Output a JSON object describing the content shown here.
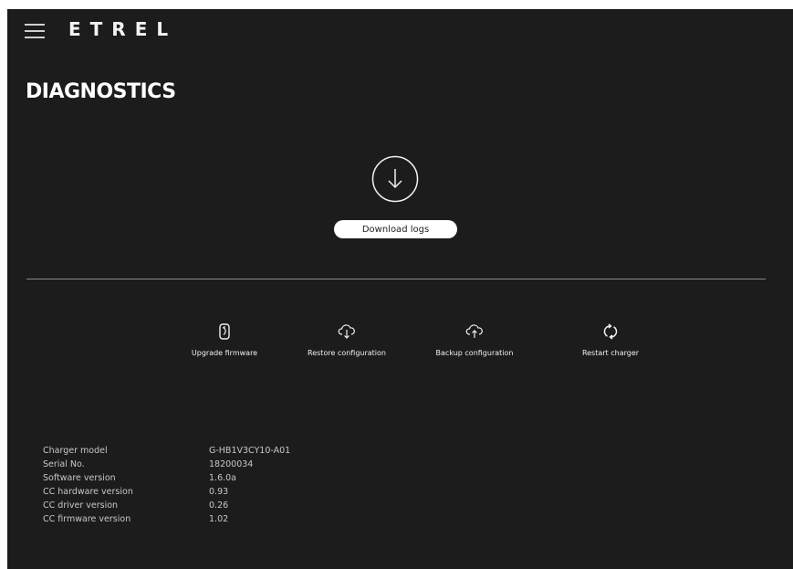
{
  "header": {
    "menu_icon": "hamburger-menu-icon",
    "logo_text": "ETREL"
  },
  "page": {
    "title": "DIAGNOSTICS"
  },
  "download": {
    "icon": "download-arrow-icon",
    "button_label": "Download logs"
  },
  "actions": [
    {
      "icon": "firmware-upgrade-icon",
      "label": "Upgrade firmware"
    },
    {
      "icon": "cloud-download-icon",
      "label": "Restore configuration"
    },
    {
      "icon": "cloud-upload-icon",
      "label": "Backup configuration"
    },
    {
      "icon": "restart-icon",
      "label": "Restart charger"
    }
  ],
  "info": [
    {
      "key": "Charger model",
      "value": "G-HB1V3CY10-A01"
    },
    {
      "key": "Serial No.",
      "value": "18200034"
    },
    {
      "key": "Software version",
      "value": "1.6.0a"
    },
    {
      "key": "CC hardware version",
      "value": "0.93"
    },
    {
      "key": "CC driver version",
      "value": "0.26"
    },
    {
      "key": "CC firmware version",
      "value": "1.02"
    }
  ],
  "colors": {
    "background": "#1c1c1c",
    "text": "#e8e8e8",
    "button_bg": "#ffffff"
  }
}
